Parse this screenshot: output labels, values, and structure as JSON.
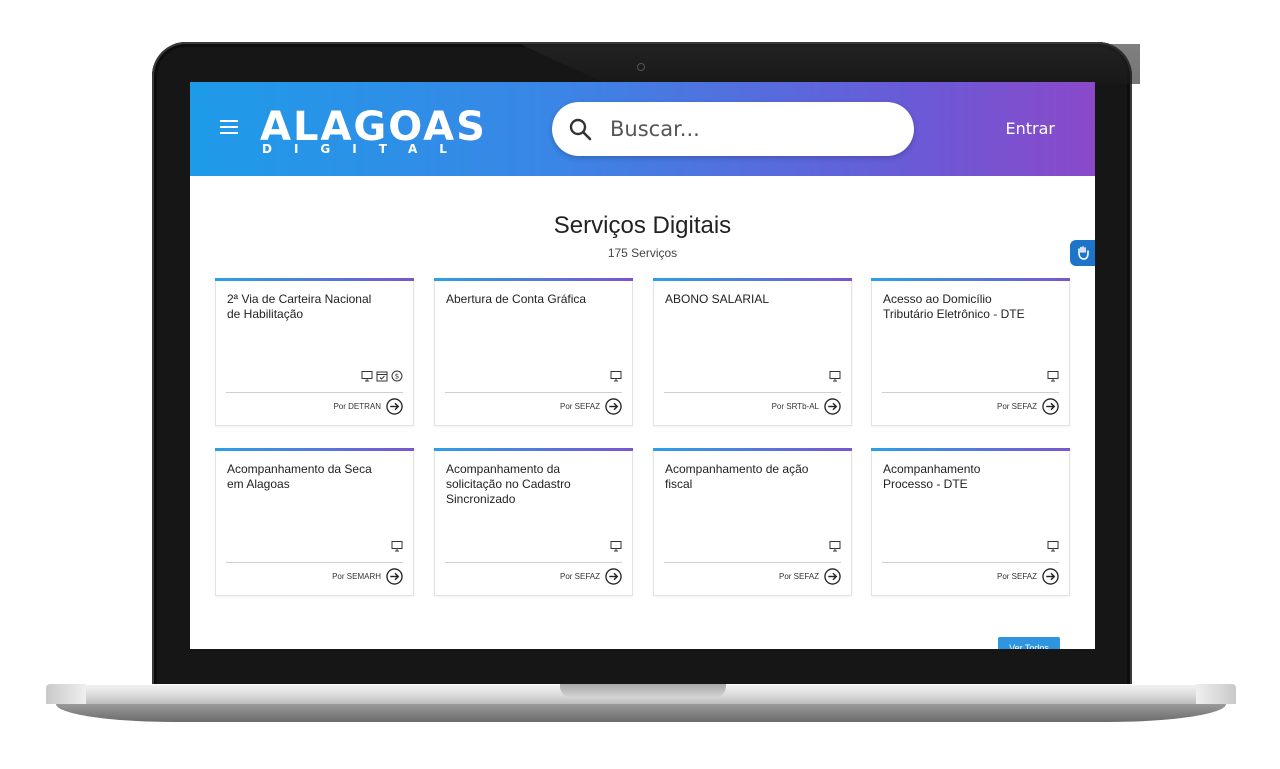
{
  "header": {
    "logo_title": "ALAGOAS",
    "logo_subtitle": "DIGITAL",
    "search_placeholder": "Buscar...",
    "login_label": "Entrar"
  },
  "main": {
    "title": "Serviços Digitais",
    "count": "175 Serviços",
    "see_all_label": "Ver Todos"
  },
  "services": [
    {
      "title": "2ª Via de Carteira Nacional de Habilitação",
      "org": "Por DETRAN",
      "icons": [
        "monitor-icon",
        "calendar-icon",
        "dollar-icon"
      ]
    },
    {
      "title": "Abertura de Conta Gráfica",
      "org": "Por SEFAZ",
      "icons": [
        "monitor-icon"
      ]
    },
    {
      "title": "ABONO SALARIAL",
      "org": "Por SRTb-AL",
      "icons": [
        "monitor-icon"
      ]
    },
    {
      "title": "Acesso ao Domicílio Tributário Eletrônico - DTE",
      "org": "Por SEFAZ",
      "icons": [
        "monitor-icon"
      ]
    },
    {
      "title": "Acompanhamento da Seca em Alagoas",
      "org": "Por SEMARH",
      "icons": [
        "monitor-icon"
      ]
    },
    {
      "title": "Acompanhamento da solicitação no Cadastro Sincronizado",
      "org": "Por SEFAZ",
      "icons": [
        "monitor-icon"
      ]
    },
    {
      "title": "Acompanhamento de ação fiscal",
      "org": "Por SEFAZ",
      "icons": [
        "monitor-icon"
      ]
    },
    {
      "title": "Acompanhamento Processo - DTE",
      "org": "Por SEFAZ",
      "icons": [
        "monitor-icon"
      ]
    }
  ],
  "colors": {
    "header_start": "#1e9be8",
    "header_end": "#8a49c9",
    "accent": "#2f95e0"
  }
}
